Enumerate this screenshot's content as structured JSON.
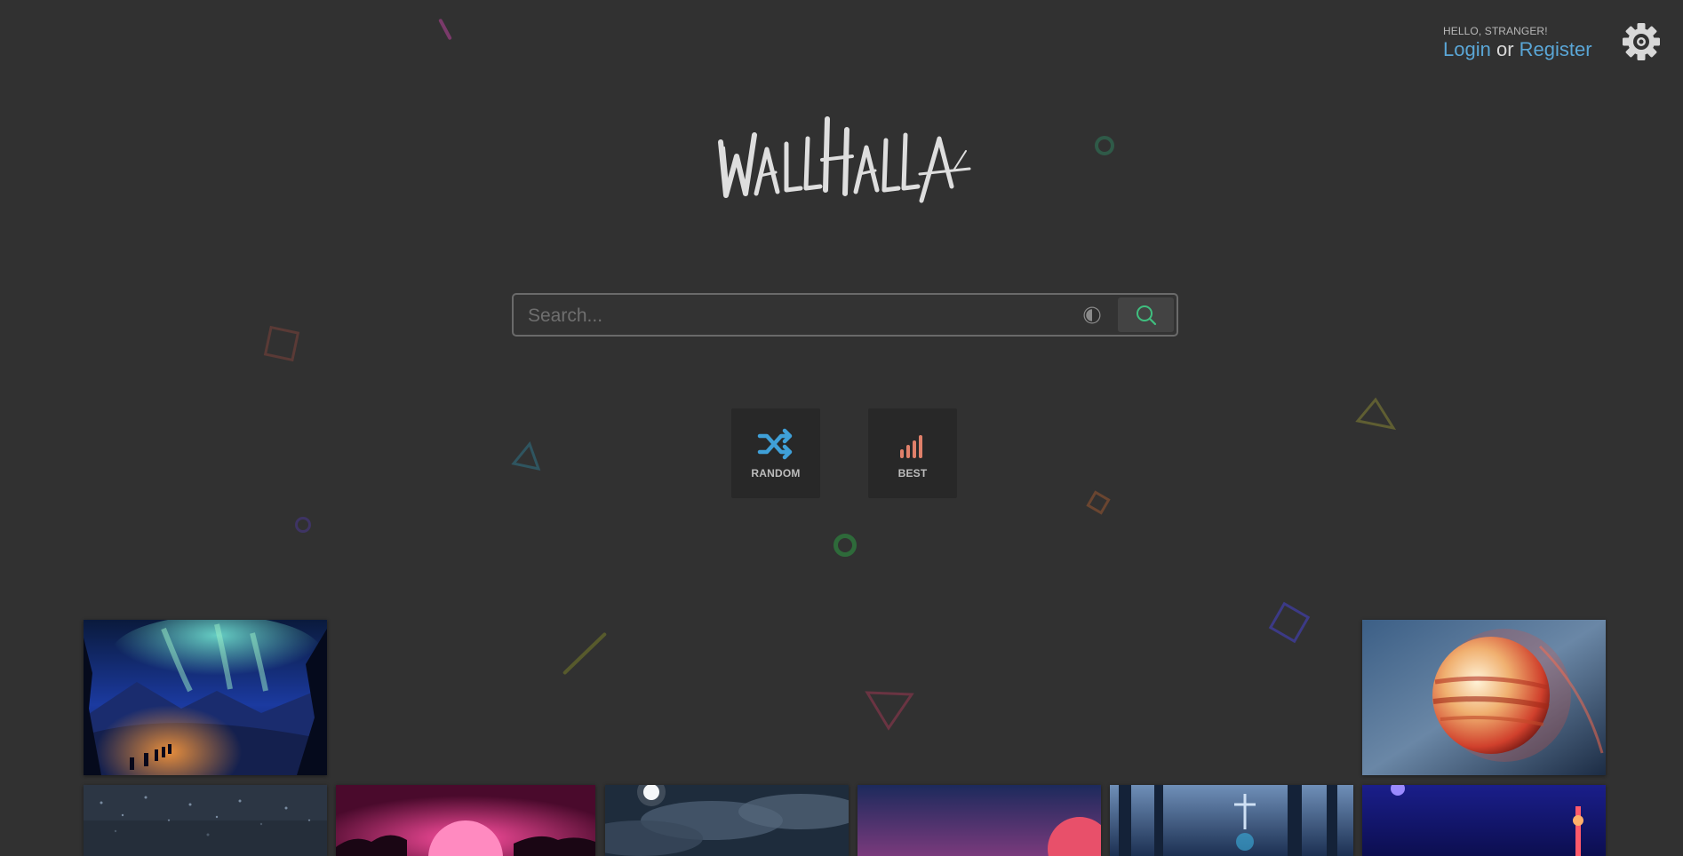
{
  "app": {
    "name": "Wallhalla",
    "logo_text": "WALLHALLA"
  },
  "header": {
    "greeting": "HELLO, STRANGER!",
    "login_label": "Login",
    "or_label": "or",
    "register_label": "Register",
    "settings_icon": "gear-icon"
  },
  "search": {
    "placeholder": "Search...",
    "value": "",
    "contrast_icon": "contrast-icon",
    "submit_icon": "search-icon"
  },
  "quick_actions": [
    {
      "label": "RANDOM",
      "icon": "shuffle-icon",
      "color": "#3fa0d8"
    },
    {
      "label": "BEST",
      "icon": "signal-bars-icon",
      "color": "#e0806a"
    }
  ],
  "colors": {
    "background": "#313131",
    "link": "#5aa6d6",
    "search_icon": "#3fbf7f"
  },
  "thumbnails": [
    {
      "subject": "aurora-night-wallpaper"
    },
    {
      "subject": "planet-wallpaper"
    },
    {
      "subject": "city-lights-wallpaper"
    },
    {
      "subject": "pink-sun-wallpaper"
    },
    {
      "subject": "moon-clouds-wallpaper"
    },
    {
      "subject": "purple-sunset-wallpaper"
    },
    {
      "subject": "blue-forest-wallpaper"
    },
    {
      "subject": "night-tower-wallpaper"
    }
  ]
}
